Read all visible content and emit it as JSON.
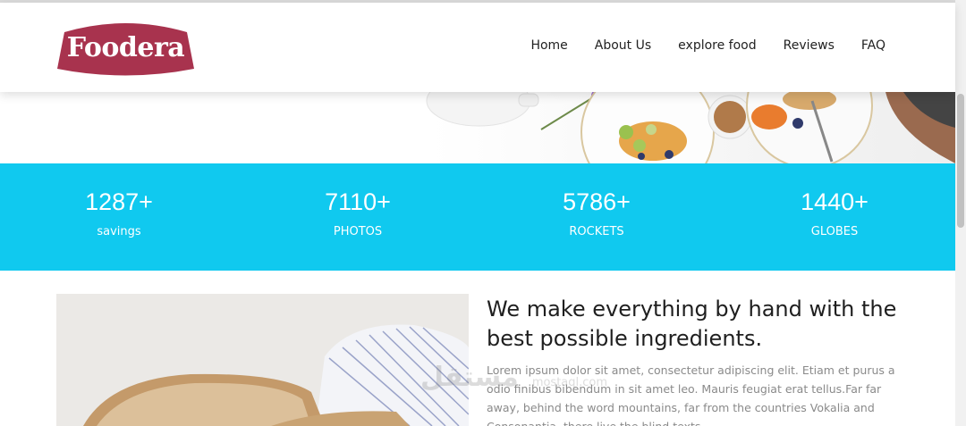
{
  "brand": {
    "name": "Foodera",
    "color": "#a8334e"
  },
  "nav": {
    "items": [
      {
        "label": "Home"
      },
      {
        "label": "About Us"
      },
      {
        "label": "explore food"
      },
      {
        "label": "Reviews"
      },
      {
        "label": "FAQ"
      }
    ]
  },
  "stats": {
    "background": "#10c9ef",
    "items": [
      {
        "number": "1287+",
        "label": "savings"
      },
      {
        "number": "7110+",
        "label": "PHOTOS"
      },
      {
        "number": "5786+",
        "label": "ROCKETS"
      },
      {
        "number": "1440+",
        "label": "GLOBES"
      }
    ]
  },
  "about": {
    "heading": "We make everything by hand with the best possible ingredients.",
    "body": "Lorem ipsum dolor sit amet, consectetur adipiscing elit. Etiam et purus a odio finibus bibendum in sit amet leo. Mauris feugiat erat tellus.Far far away, behind the word mountains, far from the countries Vokalia and Consonantia, there live the blind texts."
  },
  "watermark": {
    "arabic": "مستقل",
    "latin": "mostaql.com"
  }
}
